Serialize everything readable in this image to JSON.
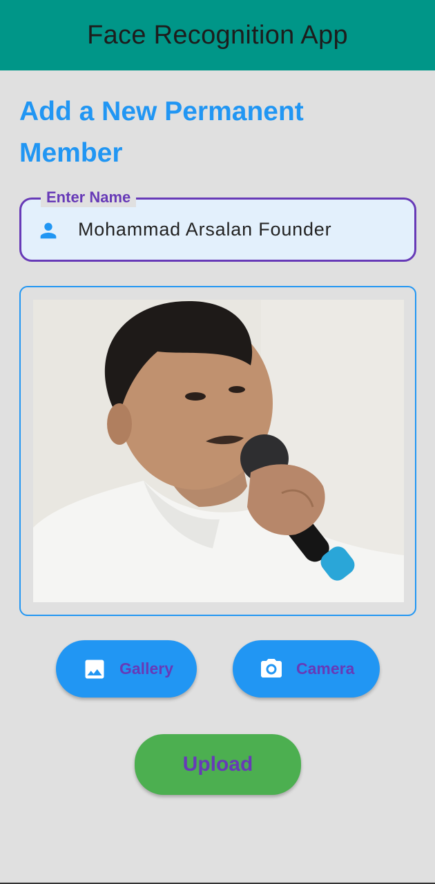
{
  "appbar": {
    "title": "Face Recognition App"
  },
  "page": {
    "heading": "Add a New Permanent Member"
  },
  "name_field": {
    "label": "Enter Name",
    "value": "Mohammad Arsalan Founder",
    "icon": "person-icon"
  },
  "image_preview": {
    "alt": "Selected photo of a man speaking into a microphone"
  },
  "actions": {
    "gallery": {
      "label": "Gallery",
      "icon": "image-icon"
    },
    "camera": {
      "label": "Camera",
      "icon": "camera-icon"
    },
    "upload": {
      "label": "Upload"
    }
  },
  "colors": {
    "appbar": "#009688",
    "accent": "#2196f3",
    "label": "#673ab7",
    "upload": "#4caf50",
    "background": "#e0e0e0"
  }
}
